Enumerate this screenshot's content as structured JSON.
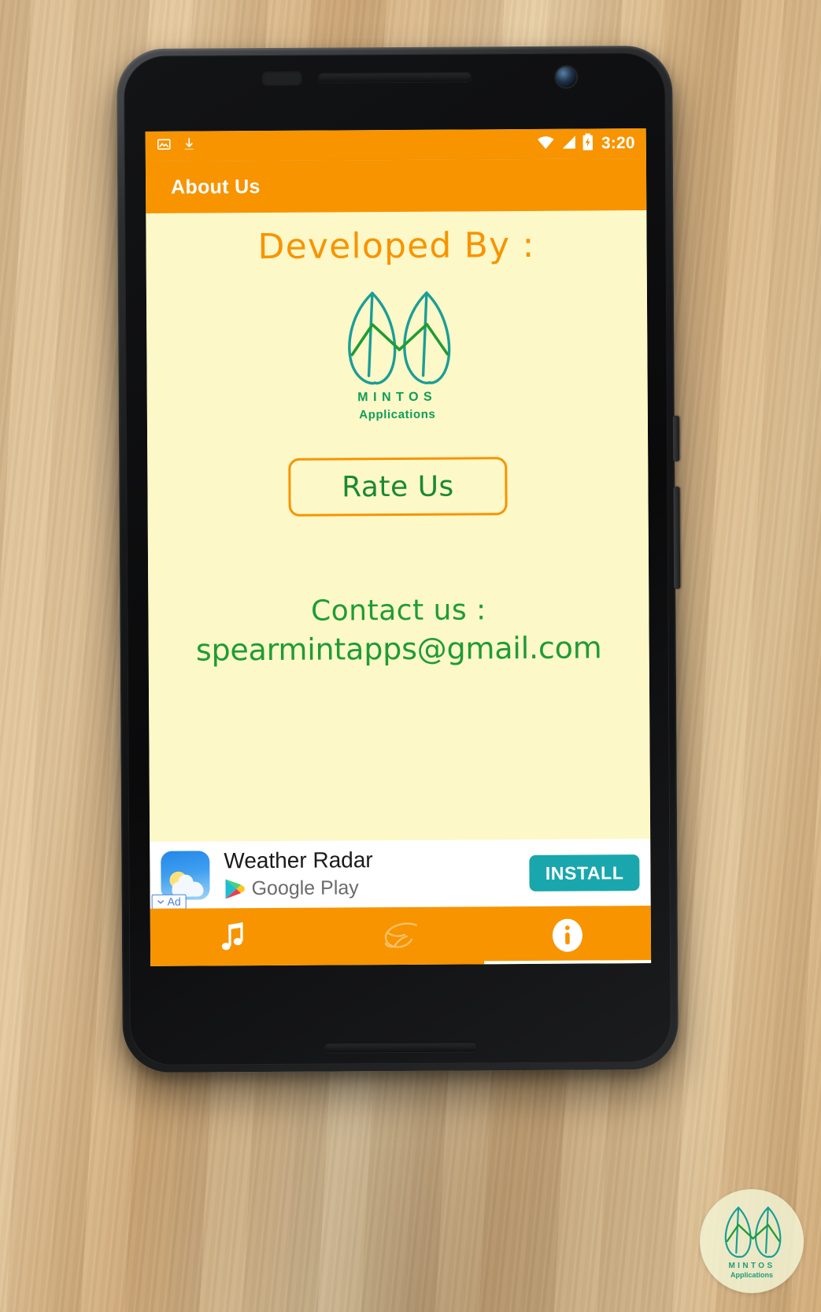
{
  "statusbar": {
    "clock": "3:20",
    "icons": [
      "image-icon",
      "download-icon",
      "wifi-icon",
      "signal-icon",
      "battery-charging-icon"
    ]
  },
  "appbar": {
    "title": "About Us"
  },
  "content": {
    "heading": "Developed By :",
    "logo": {
      "name": "MINTOS",
      "subtitle": "Applications"
    },
    "rate_button": "Rate Us",
    "contact_label": "Contact us :",
    "contact_email": "spearmintapps@gmail.com"
  },
  "ad": {
    "title": "Weather Radar",
    "store": "Google Play",
    "install_label": "INSTALL",
    "badge_label": "Ad"
  },
  "bottom_nav": [
    {
      "name": "music",
      "icon": "music-note-icon",
      "active": false
    },
    {
      "name": "mint",
      "icon": "mint-leaf-icon",
      "active": false
    },
    {
      "name": "info",
      "icon": "info-circle-icon",
      "active": true
    }
  ],
  "watermark": {
    "name": "MINTOS",
    "subtitle": "Applications"
  },
  "colors": {
    "accent_orange": "#f79400",
    "screen_bg": "#fcf8c8",
    "green_text": "#1f9c34",
    "logo_teal": "#1a9e96",
    "logo_green": "#1f9c34",
    "install_teal": "#19a7ad"
  }
}
